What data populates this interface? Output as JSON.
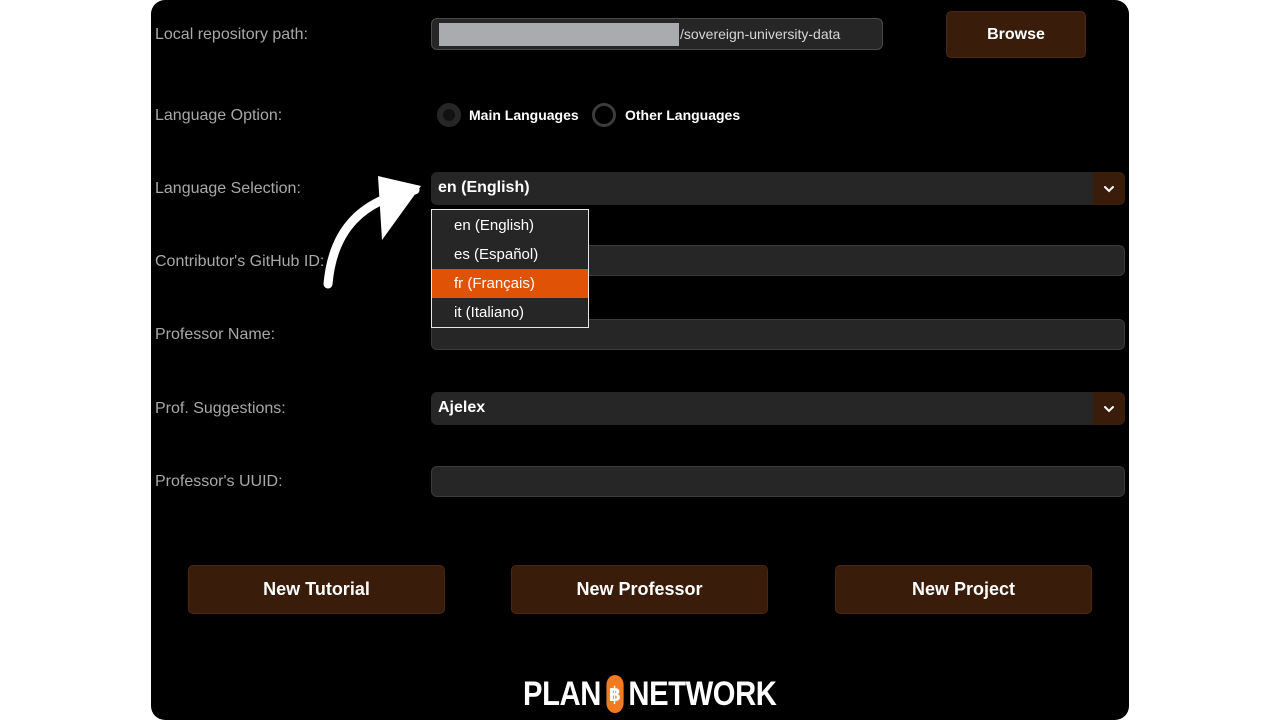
{
  "form": {
    "repo_path": {
      "label": "Local repository path:",
      "value": "/sovereign-university-data"
    },
    "browse_label": "Browse",
    "language_option": {
      "label": "Language Option:",
      "main_label": "Main Languages",
      "other_label": "Other Languages",
      "selected": "Main Languages"
    },
    "language_selection": {
      "label": "Language Selection:",
      "value": "en (English)",
      "options": [
        "en (English)",
        "es (Español)",
        "fr (Français)",
        "it (Italiano)"
      ],
      "highlighted": "fr (Français)"
    },
    "github_id": {
      "label": "Contributor's GitHub ID:",
      "value": ""
    },
    "professor_name": {
      "label": "Professor Name:",
      "value": ""
    },
    "prof_suggestions": {
      "label": "Prof. Suggestions:",
      "value": "Ajelex"
    },
    "professor_uuid": {
      "label": "Professor's UUID:",
      "value": ""
    }
  },
  "actions": {
    "new_tutorial": "New Tutorial",
    "new_professor": "New Professor",
    "new_project": "New Project"
  },
  "logo": {
    "left": "PLAN",
    "coin": "฿",
    "right": "NETWORK"
  },
  "colors": {
    "background": "#000000",
    "field": "#262626",
    "button": "#3a1c0a",
    "highlight": "#e05206",
    "logo_accent": "#f27a21"
  },
  "icons": {
    "dropdown": "chevron-down-icon",
    "annotation": "curved-arrow-icon"
  }
}
